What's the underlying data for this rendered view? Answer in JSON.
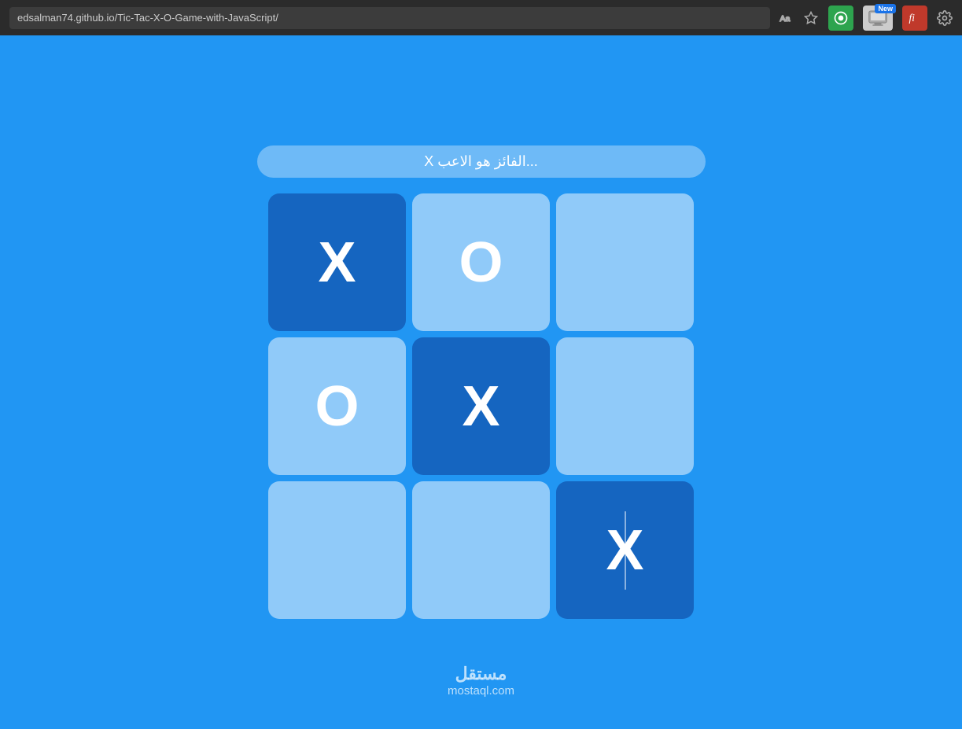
{
  "browser": {
    "url": "edsalman74.github.io/Tic-Tac-X-O-Game-with-JavaScript/",
    "new_badge": "New"
  },
  "game": {
    "status": "...الفائز هو الاعب X",
    "board": [
      {
        "id": 0,
        "value": "X",
        "dark": true
      },
      {
        "id": 1,
        "value": "O",
        "dark": false
      },
      {
        "id": 2,
        "value": "",
        "dark": false
      },
      {
        "id": 3,
        "value": "O",
        "dark": false
      },
      {
        "id": 4,
        "value": "X",
        "dark": true
      },
      {
        "id": 5,
        "value": "",
        "dark": false
      },
      {
        "id": 6,
        "value": "",
        "dark": false
      },
      {
        "id": 7,
        "value": "",
        "dark": false
      },
      {
        "id": 8,
        "value": "X",
        "dark": true
      }
    ],
    "watermark_arabic": "مستقل",
    "watermark_latin": "mostaql.com"
  }
}
